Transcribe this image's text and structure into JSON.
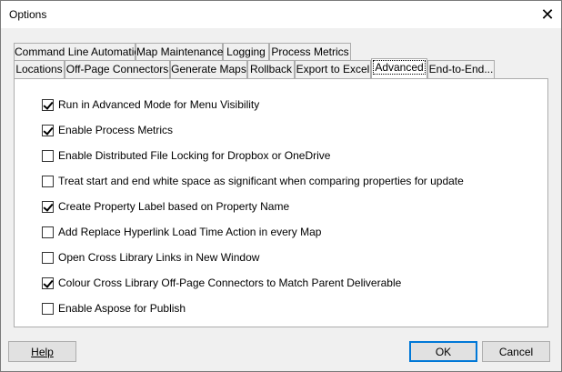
{
  "window": {
    "title": "Options",
    "close_glyph": "✕"
  },
  "tabs_row_top": [
    {
      "label": "Command Line Automation"
    },
    {
      "label": "Map Maintenance"
    },
    {
      "label": "Logging"
    },
    {
      "label": "Process Metrics"
    }
  ],
  "tabs_row_bottom": [
    {
      "label": "Locations"
    },
    {
      "label": "Off-Page Connectors"
    },
    {
      "label": "Generate Maps"
    },
    {
      "label": "Rollback"
    },
    {
      "label": "Export to Excel"
    },
    {
      "label": "Advanced",
      "selected": true
    },
    {
      "label": "End-to-End..."
    }
  ],
  "options": [
    {
      "label": "Run in Advanced Mode for Menu Visibility",
      "checked": true
    },
    {
      "label": "Enable Process Metrics",
      "checked": true
    },
    {
      "label": "Enable Distributed File Locking for Dropbox or OneDrive",
      "checked": false
    },
    {
      "label": "Treat start and end white space as significant when comparing properties for update",
      "checked": false
    },
    {
      "label": "Create Property Label based on Property Name",
      "checked": true
    },
    {
      "label": "Add Replace Hyperlink Load Time Action in every Map",
      "checked": false
    },
    {
      "label": "Open Cross Library Links in New Window",
      "checked": false
    },
    {
      "label": "Colour Cross Library Off-Page Connectors to Match Parent Deliverable",
      "checked": true
    },
    {
      "label": "Enable Aspose for Publish",
      "checked": false
    }
  ],
  "buttons": {
    "help": "Help",
    "ok": "OK",
    "cancel": "Cancel"
  },
  "colors": {
    "window_bg": "#f0f0f0",
    "panel_bg": "#ffffff",
    "default_button_border": "#0078d7"
  }
}
